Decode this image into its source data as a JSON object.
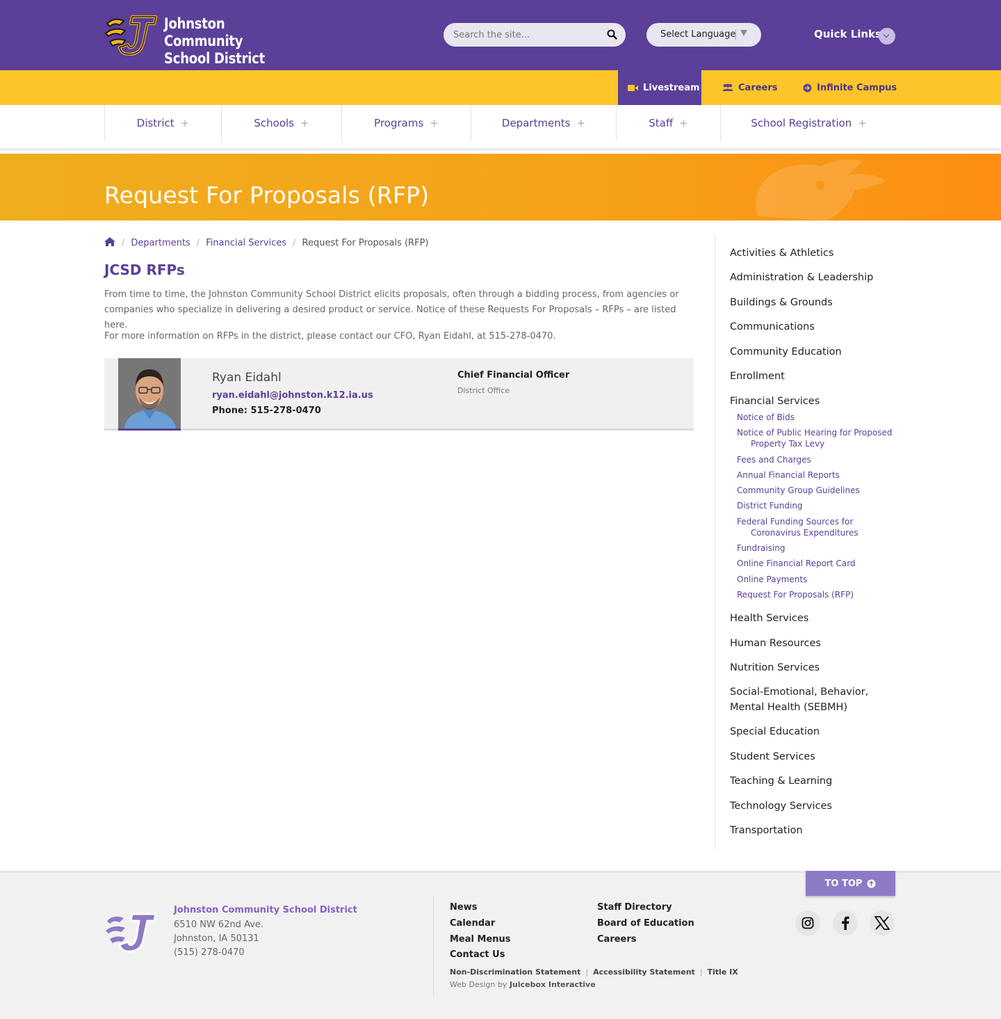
{
  "header": {
    "org_line1": "Johnston Community",
    "org_line2": "School District",
    "search_placeholder": "Search the site...",
    "language_label": "Select Language",
    "quick_links_label": "Quick Links",
    "brand_color": "#5b3f98",
    "accent_color": "#fdc52a"
  },
  "utility": {
    "livestream": "Livestream",
    "careers": "Careers",
    "infinite_campus": "Infinite Campus"
  },
  "nav": {
    "items": [
      {
        "label": "District"
      },
      {
        "label": "Schools"
      },
      {
        "label": "Programs"
      },
      {
        "label": "Departments"
      },
      {
        "label": "Staff"
      },
      {
        "label": "School Registration"
      }
    ],
    "expand_glyph": "+"
  },
  "banner": {
    "title": "Request For Proposals (RFP)"
  },
  "breadcrumb": {
    "home_icon": "home-icon",
    "items": [
      "Departments",
      "Financial Services"
    ],
    "current": "Request For Proposals (RFP)",
    "separator": "/"
  },
  "content": {
    "heading": "JCSD RFPs",
    "paragraph1": "From time to time, the Johnston Community School District elicits proposals, often through a bidding process, from agencies or companies who specialize in delivering a desired product or service. Notice of these Requests For Proposals – RFPs – are listed here.",
    "paragraph2": "For more information on RFPs in the district, please contact our CFO, Ryan Eidahl, at 515-278-0470."
  },
  "contact": {
    "name": "Ryan Eidahl",
    "email": "ryan.eidahl@johnston.k12.ia.us",
    "phone_label": "Phone:",
    "phone": "515-278-0470",
    "role": "Chief Financial Officer",
    "office": "District Office"
  },
  "sidebar": {
    "items": [
      "Activities & Athletics",
      "Administration & Leadership",
      "Buildings & Grounds",
      "Communications",
      "Community Education",
      "Enrollment",
      "Financial Services",
      "Health Services",
      "Human Resources",
      "Nutrition Services",
      "Social-Emotional, Behavior, Mental Health (SEBMH)",
      "Special Education",
      "Student Services",
      "Teaching & Learning",
      "Technology Services",
      "Transportation"
    ],
    "subitems": [
      {
        "line1": "Notice of Bids",
        "line2": ""
      },
      {
        "line1": "Notice of Public Hearing for Proposed",
        "line2": "Property Tax Levy"
      },
      {
        "line1": "Fees and Charges",
        "line2": ""
      },
      {
        "line1": "Annual Financial Reports",
        "line2": ""
      },
      {
        "line1": "Community Group Guidelines",
        "line2": ""
      },
      {
        "line1": "District Funding",
        "line2": ""
      },
      {
        "line1": "Federal Funding Sources for",
        "line2": "Coronavirus Expenditures"
      },
      {
        "line1": "Fundraising",
        "line2": ""
      },
      {
        "line1": "Online Financial Report Card",
        "line2": ""
      },
      {
        "line1": "Online Payments",
        "line2": ""
      },
      {
        "line1": "Request For Proposals (RFP)",
        "line2": ""
      }
    ]
  },
  "footer": {
    "to_top": "TO TOP",
    "org": "Johnston Community School District",
    "address1": "6510 NW 62nd Ave.",
    "address2": "Johnston, IA 50131",
    "phone": "(515) 278-0470",
    "links_col1": [
      "News",
      "Calendar",
      "Meal Menus",
      "Contact Us"
    ],
    "links_col2": [
      "Staff Directory",
      "Board of Education",
      "Careers"
    ],
    "legal": [
      "Non-Discrimination Statement",
      "Accessibility Statement",
      "Title IX"
    ],
    "credit_prefix": "Web Design by",
    "credit_name": "Juicebox Interactive",
    "social": [
      "instagram-icon",
      "facebook-icon",
      "x-icon"
    ]
  }
}
